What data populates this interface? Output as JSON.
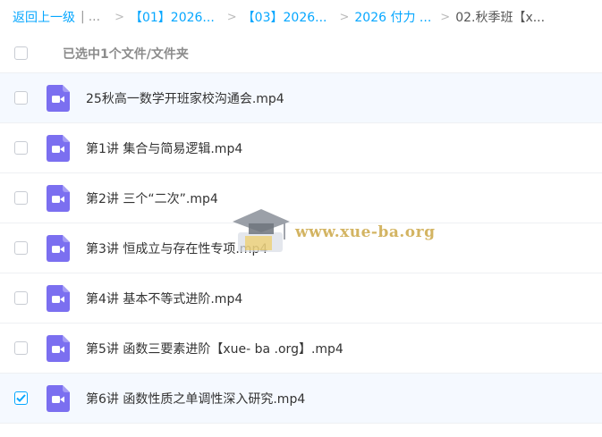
{
  "breadcrumb": {
    "back": "返回上一级",
    "sep_bar": "|",
    "ellipsis": "...",
    "items": [
      "【01】2026...",
      "【03】2026...",
      "2026 付力 ...",
      "02.秋季班【x..."
    ]
  },
  "selection": {
    "text": "已选中1个文件/文件夹"
  },
  "files": [
    {
      "name": "25秋高一数学开班家校沟通会.mp4",
      "checked": false
    },
    {
      "name": "第1讲 集合与简易逻辑.mp4",
      "checked": false
    },
    {
      "name": "第2讲 三个“二次”.mp4",
      "checked": false
    },
    {
      "name": "第3讲 恒成立与存在性专项.mp4",
      "checked": false
    },
    {
      "name": "第4讲 基本不等式进阶.mp4",
      "checked": false
    },
    {
      "name": "第5讲 函数三要素进阶【xue- ba .org】.mp4",
      "checked": false
    },
    {
      "name": "第6讲 函数性质之单调性深入研究.mp4",
      "checked": true
    }
  ],
  "watermark": {
    "text": "www.xue-ba.org"
  },
  "colors": {
    "accent": "#06a7ff",
    "video_icon": "#7b6ff0"
  },
  "icons": {
    "file": "video-file-icon",
    "check": "checkmark-icon"
  }
}
